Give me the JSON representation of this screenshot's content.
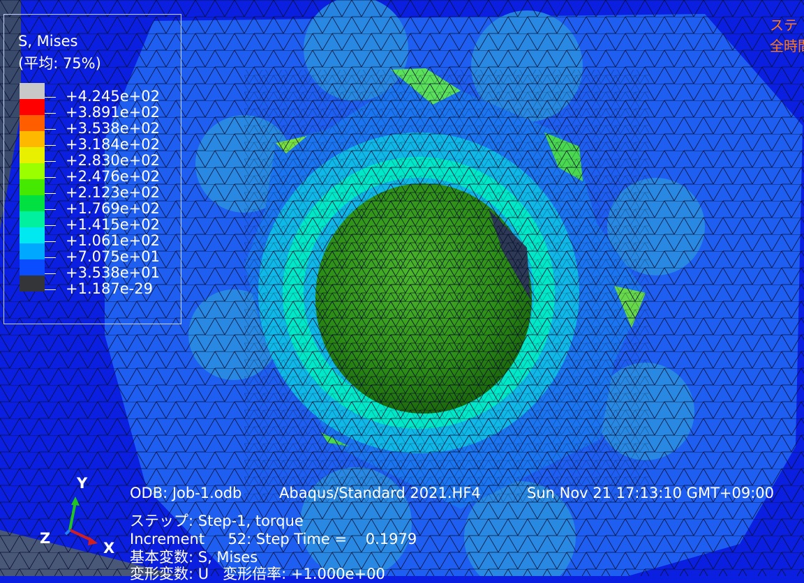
{
  "legend": {
    "title": "S, Mises",
    "subtitle": "(平均: 75%)",
    "levels": [
      {
        "label": "+4.245e+02",
        "color": "#c8c8c8"
      },
      {
        "label": "+3.891e+02",
        "color": "#ff0000"
      },
      {
        "label": "+3.538e+02",
        "color": "#ff5e00"
      },
      {
        "label": "+3.184e+02",
        "color": "#ffb800"
      },
      {
        "label": "+2.830e+02",
        "color": "#e8f000"
      },
      {
        "label": "+2.476e+02",
        "color": "#9cff00"
      },
      {
        "label": "+2.123e+02",
        "color": "#44e800"
      },
      {
        "label": "+1.769e+02",
        "color": "#00e040"
      },
      {
        "label": "+1.415e+02",
        "color": "#00f0a0"
      },
      {
        "label": "+1.061e+02",
        "color": "#00e8f0"
      },
      {
        "label": "+7.075e+01",
        "color": "#00a8ff"
      },
      {
        "label": "+3.538e+01",
        "color": "#0a4dff"
      },
      {
        "label": "+1.187e-29",
        "color": "#333538"
      }
    ]
  },
  "info": {
    "odb": "ODB: Job-1.odb",
    "solver": "Abaqus/Standard 2021.HF4",
    "date": "Sun Nov 21 17:13:10 GMT+09:00",
    "step": "ステップ: Step-1, torque",
    "increment": "Increment     52: Step Time =    0.1979",
    "primary_var": "基本変数: S, Mises",
    "deformed_var": "変形変数: U   変形倍率: +1.000e+00"
  },
  "corner_text": {
    "line1": "ステ",
    "line2": "全時間"
  },
  "triad": {
    "y": "Y",
    "z": "Z",
    "x": "X"
  },
  "colors": {
    "background": "#0b1fe0",
    "info_text": "#ffffff",
    "corner_text": "#ff7a1a"
  }
}
